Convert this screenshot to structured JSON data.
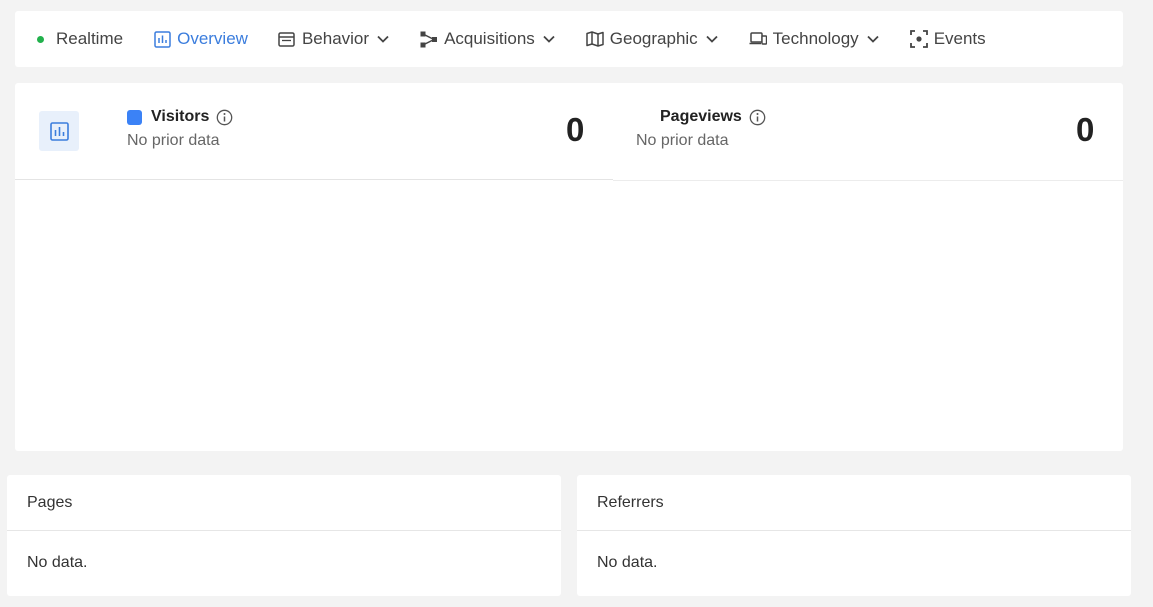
{
  "nav": {
    "items": [
      {
        "label": "Realtime",
        "icon": "status-dot",
        "active": false,
        "dropdown": false
      },
      {
        "label": "Overview",
        "icon": "bar-chart-icon",
        "active": true,
        "dropdown": false
      },
      {
        "label": "Behavior",
        "icon": "browser-window-icon",
        "active": false,
        "dropdown": true
      },
      {
        "label": "Acquisitions",
        "icon": "share-nodes-icon",
        "active": false,
        "dropdown": true
      },
      {
        "label": "Geographic",
        "icon": "map-icon",
        "active": false,
        "dropdown": true
      },
      {
        "label": "Technology",
        "icon": "devices-icon",
        "active": false,
        "dropdown": true
      },
      {
        "label": "Events",
        "icon": "focus-target-icon",
        "active": false,
        "dropdown": false
      }
    ]
  },
  "stats": {
    "visitors": {
      "label": "Visitors",
      "sub": "No prior data",
      "value": "0",
      "color": "#3b82f6"
    },
    "pageviews": {
      "label": "Pageviews",
      "sub": "No prior data",
      "value": "0"
    }
  },
  "panels": {
    "pages": {
      "title": "Pages",
      "empty": "No data."
    },
    "referrers": {
      "title": "Referrers",
      "empty": "No data."
    }
  },
  "colors": {
    "accent": "#3b7ddd",
    "realtime_dot": "#22b14c",
    "visitors_swatch": "#3b82f6"
  }
}
